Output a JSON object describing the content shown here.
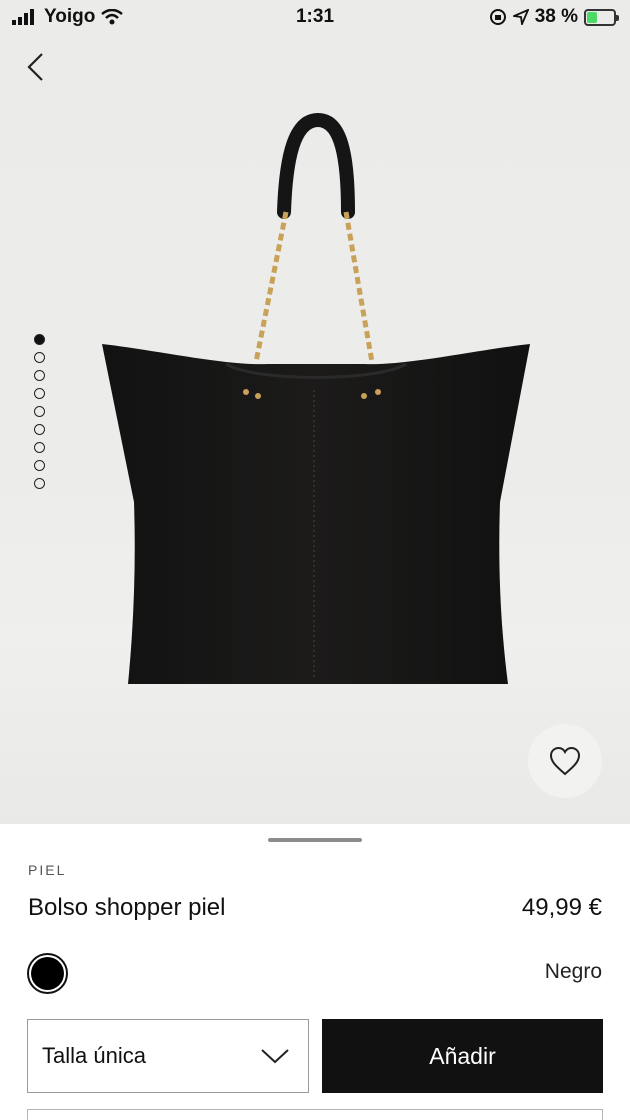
{
  "status": {
    "carrier": "Yoigo",
    "time": "1:31",
    "battery": "38 %",
    "battery_level": 0.38
  },
  "gallery": {
    "image_count": 9,
    "active_index": 0
  },
  "icons": {
    "back": "chevron-left-icon",
    "favorite": "heart-icon",
    "dropdown": "chevron-down-icon"
  },
  "product": {
    "category": "PIEL",
    "name": "Bolso shopper piel",
    "price": "49,99 €",
    "color_name": "Negro",
    "color_hex": "#000000",
    "size_value": "Talla única",
    "add_label": "Añadir"
  }
}
